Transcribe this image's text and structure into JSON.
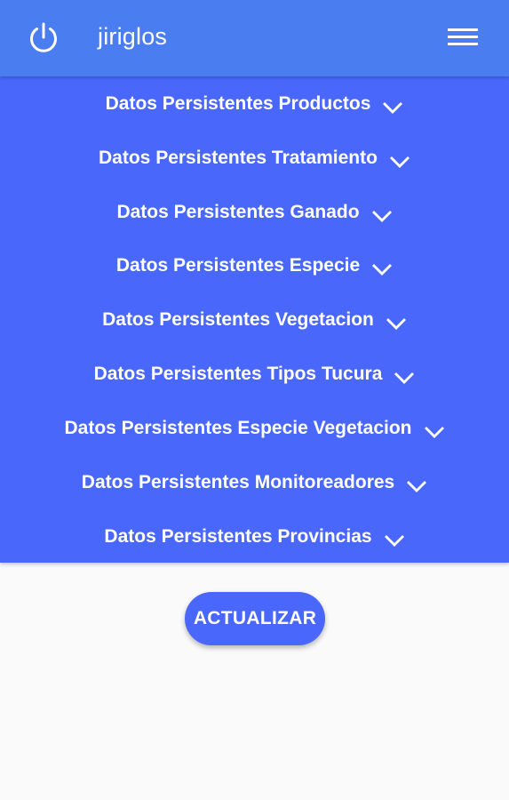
{
  "app": {
    "title": "jiriglos"
  },
  "colors": {
    "appbar": "#4a7ef0",
    "panel": "#4a67fb",
    "button": "#4a67fb",
    "background": "#fafafa",
    "text": "#ffffff"
  },
  "icons": {
    "power": "power-icon",
    "menu": "hamburger-menu-icon",
    "expand": "chevron-down-icon"
  },
  "sections": [
    {
      "label": "Datos Persistentes Productos"
    },
    {
      "label": "Datos Persistentes Tratamiento"
    },
    {
      "label": "Datos Persistentes Ganado"
    },
    {
      "label": "Datos Persistentes Especie"
    },
    {
      "label": "Datos Persistentes Vegetacion"
    },
    {
      "label": "Datos Persistentes Tipos Tucura"
    },
    {
      "label": "Datos Persistentes Especie Vegetacion"
    },
    {
      "label": "Datos Persistentes Monitoreadores"
    },
    {
      "label": "Datos Persistentes Provincias"
    }
  ],
  "actions": {
    "update_label": "ACTUALIZAR"
  }
}
